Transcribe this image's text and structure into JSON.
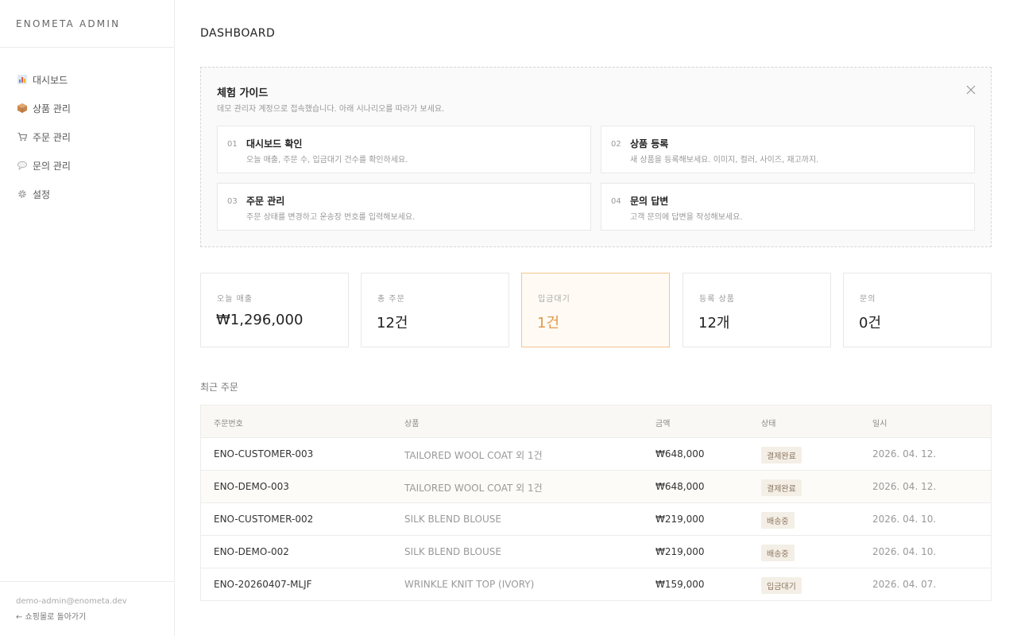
{
  "sidebar": {
    "brand": "ENOMETA ADMIN",
    "items": [
      {
        "label": "대시보드",
        "icon": "chart-icon"
      },
      {
        "label": "상품 관리",
        "icon": "box-icon"
      },
      {
        "label": "주문 관리",
        "icon": "cart-icon"
      },
      {
        "label": "문의 관리",
        "icon": "speech-bubble-icon"
      },
      {
        "label": "설정",
        "icon": "gear-icon"
      }
    ],
    "footer_email": "demo-admin@enometa.dev",
    "footer_link": "← 쇼핑몰로 돌아가기"
  },
  "header": {
    "title": "DASHBOARD"
  },
  "guide": {
    "title": "체험 가이드",
    "description": "데모 관리자 계정으로 접속했습니다. 아래 시나리오를 따라가 보세요.",
    "steps": [
      {
        "num": "01",
        "title": "대시보드 확인",
        "desc": "오늘 매출, 주문 수, 입금대기 건수를 확인하세요."
      },
      {
        "num": "02",
        "title": "상품 등록",
        "desc": "새 상품을 등록해보세요. 이미지, 컬러, 사이즈, 재고까지."
      },
      {
        "num": "03",
        "title": "주문 관리",
        "desc": "주문 상태를 변경하고 운송장 번호를 입력해보세요."
      },
      {
        "num": "04",
        "title": "문의 답변",
        "desc": "고객 문의에 답변을 작성해보세요."
      }
    ]
  },
  "stats": [
    {
      "label": "오늘 매출",
      "value": "₩1,296,000",
      "highlight": false
    },
    {
      "label": "총 주문",
      "value": "12건",
      "highlight": false
    },
    {
      "label": "입금대기",
      "value": "1건",
      "highlight": true
    },
    {
      "label": "등록 상품",
      "value": "12개",
      "highlight": false
    },
    {
      "label": "문의",
      "value": "0건",
      "highlight": false
    }
  ],
  "recent_orders": {
    "title": "최근 주문",
    "columns": [
      "주문번호",
      "상품",
      "금액",
      "상태",
      "일시"
    ],
    "rows": [
      {
        "id": "ENO-CUSTOMER-003",
        "product": "TAILORED WOOL COAT 외 1건",
        "amount": "₩648,000",
        "status": "결제완료",
        "date": "2026. 04. 12."
      },
      {
        "id": "ENO-DEMO-003",
        "product": "TAILORED WOOL COAT 외 1건",
        "amount": "₩648,000",
        "status": "결제완료",
        "date": "2026. 04. 12."
      },
      {
        "id": "ENO-CUSTOMER-002",
        "product": "SILK BLEND BLOUSE",
        "amount": "₩219,000",
        "status": "배송중",
        "date": "2026. 04. 10."
      },
      {
        "id": "ENO-DEMO-002",
        "product": "SILK BLEND BLOUSE",
        "amount": "₩219,000",
        "status": "배송중",
        "date": "2026. 04. 10."
      },
      {
        "id": "ENO-20260407-MLJF",
        "product": "WRINKLE KNIT TOP (IVORY)",
        "amount": "₩159,000",
        "status": "입금대기",
        "date": "2026. 04. 07."
      }
    ]
  },
  "colors": {
    "accent": "#e09a4a",
    "accent_border": "#f3c58e",
    "badge_bg": "#f4efe6"
  }
}
